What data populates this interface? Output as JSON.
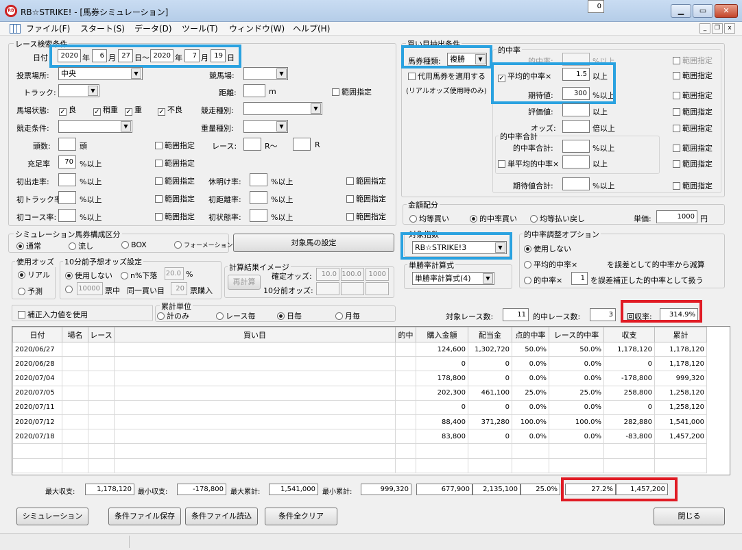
{
  "window": {
    "title": "RB☆STRIKE! - [馬券シミュレーション]",
    "app_icon": "RB"
  },
  "menu": [
    "ファイル(F)",
    "スタート(S)",
    "データ(D)",
    "ツール(T)",
    "ウィンドウ(W)",
    "ヘルプ(H)"
  ],
  "race": {
    "legend": "レース検索条件",
    "date_label": "日付",
    "from_year": "2020",
    "from_month": "6",
    "from_day": "27",
    "to_year": "2020",
    "to_month": "7",
    "to_day": "19",
    "year_unit": "年",
    "month_unit": "月",
    "day_unit": "日〜",
    "day_unit2": "日",
    "venue_label": "投票場所:",
    "venue": "中央",
    "track_label": "競馬場:",
    "course_label": "トラック:",
    "distance_label": "距離:",
    "distance_unit": "m",
    "range": "範囲指定",
    "condition_label": "馬場状態:",
    "cond_good": "良",
    "cond_slightly": "稍重",
    "cond_heavy": "重",
    "cond_bad": "不良",
    "race_type_label": "競走種別:",
    "race_cond_label": "競走条件:",
    "weight_label": "重量種別:",
    "heads_label": "頭数:",
    "heads_unit": "頭",
    "race_label": "レース:",
    "race_r1": "R〜",
    "race_r2": "R",
    "fill_label": "充足率",
    "fill_value": "70",
    "percent_more": "%以上",
    "first_label": "初出走率:",
    "rest_label": "休明け率:",
    "first_track_label": "初トラック率:",
    "first_dist_label": "初距離率:",
    "first_course_label": "初コース率:",
    "first_state_label": "初状態率:"
  },
  "sim": {
    "legend": "シミュレーション馬券構成区分",
    "normal": "通常",
    "flow": "流し",
    "box": "BOX",
    "formation": "フォーメーション",
    "target_btn": "対象馬の設定"
  },
  "odds": {
    "legend": "使用オッズ",
    "real": "リアル",
    "forecast": "予測"
  },
  "odds10": {
    "legend": "10分前予想オッズ設定",
    "unused": "使用しない",
    "drop": "n%下落",
    "drop_val": "20.0",
    "pct": "%",
    "amount": "10000",
    "amount_unit": "票中",
    "same": "同一買い目",
    "same_val": "20",
    "same_unit": "票購入"
  },
  "calc": {
    "legend": "計算結果イメージ",
    "recalc": "再計算",
    "fixed_label": "確定オッズ:",
    "fixed": [
      "10.0",
      "100.0",
      "1000"
    ],
    "before_label": "10分前オッズ:"
  },
  "correction": "補正入力値を使用",
  "agg": {
    "legend": "累計単位",
    "total": "計のみ",
    "race": "レース毎",
    "day": "日毎",
    "month": "月毎"
  },
  "buy": {
    "legend": "買い目抽出条件",
    "ticket_label": "馬券種類:",
    "ticket": "複勝",
    "substitute": "代用馬券を適用する",
    "real_note": "(リアルオッズ使用時のみ)"
  },
  "hit": {
    "legend": "的中率",
    "hit_label": "的中率:",
    "percent_more": "%以上",
    "more": "以上",
    "times_more": "倍以上",
    "avg_label": "平均的中率×",
    "avg_val": "1.5",
    "exp_label": "期待値:",
    "exp_val": "300",
    "eval_label": "評価値:",
    "odds_label": "オッズ:",
    "range": "範囲指定",
    "total_legend": "的中率合計",
    "total_label": "的中率合計:",
    "single_label": "単平均的中率×",
    "exp_total_label": "期待値合計:"
  },
  "money": {
    "legend": "金額配分",
    "equal_buy": "均等買い",
    "hit_buy": "的中率買い",
    "equal_return": "均等払い戻し",
    "unit_label": "単価:",
    "unit_val": "1000",
    "yen": "円"
  },
  "index": {
    "legend": "対象指数",
    "value": "RB☆STRIKE!3"
  },
  "single": {
    "legend": "単勝率計算式",
    "value": "単勝率計算式(4)"
  },
  "adjust": {
    "legend": "的中率調整オプション",
    "unused": "使用しない",
    "opt2a": "平均的中率×",
    "opt2_val": "0",
    "opt2b": "を誤差として的中率から減算",
    "opt3a": "的中率×",
    "opt3_val": "1",
    "opt3b": "を誤差補正した的中率として扱う"
  },
  "summary": {
    "target_label": "対象レース数:",
    "target": "11",
    "hit_label": "的中レース数:",
    "hit": "3",
    "return_label": "回収率:",
    "return": "314.9%"
  },
  "table": {
    "headers": [
      "日付",
      "場名",
      "レース",
      "買い目",
      "的中",
      "購入金額",
      "配当金",
      "点的中率",
      "レース的中率",
      "収支",
      "累計"
    ],
    "rows": [
      [
        "2020/06/27",
        "",
        "",
        "",
        "",
        "124,600",
        "1,302,720",
        "50.0%",
        "50.0%",
        "1,178,120",
        "1,178,120"
      ],
      [
        "2020/06/28",
        "",
        "",
        "",
        "",
        "0",
        "0",
        "0.0%",
        "0.0%",
        "0",
        "1,178,120"
      ],
      [
        "2020/07/04",
        "",
        "",
        "",
        "",
        "178,800",
        "0",
        "0.0%",
        "0.0%",
        "-178,800",
        "999,320"
      ],
      [
        "2020/07/05",
        "",
        "",
        "",
        "",
        "202,300",
        "461,100",
        "25.0%",
        "25.0%",
        "258,800",
        "1,258,120"
      ],
      [
        "2020/07/11",
        "",
        "",
        "",
        "",
        "0",
        "0",
        "0.0%",
        "0.0%",
        "0",
        "1,258,120"
      ],
      [
        "2020/07/12",
        "",
        "",
        "",
        "",
        "88,400",
        "371,280",
        "100.0%",
        "100.0%",
        "282,880",
        "1,541,000"
      ],
      [
        "2020/07/18",
        "",
        "",
        "",
        "",
        "83,800",
        "0",
        "0.0%",
        "0.0%",
        "-83,800",
        "1,457,200"
      ]
    ]
  },
  "totals": {
    "max_label": "最大収支:",
    "max": "1,178,120",
    "min_label": "最小収支:",
    "min": "-178,800",
    "maxc_label": "最大累計:",
    "maxc": "1,541,000",
    "minc_label": "最小累計:",
    "minc": "999,320",
    "buy": "677,900",
    "pay": "2,135,100",
    "point": "25.0%",
    "race": "27.2%",
    "cum": "1,457,200"
  },
  "buttons": {
    "simulate": "シミュレーション",
    "save": "条件ファイル保存",
    "load": "条件ファイル読込",
    "clear": "条件全クリア",
    "close": "閉じる"
  },
  "colors": {
    "highlight_blue": "#2aa2e0",
    "highlight_red": "#e01b24"
  }
}
